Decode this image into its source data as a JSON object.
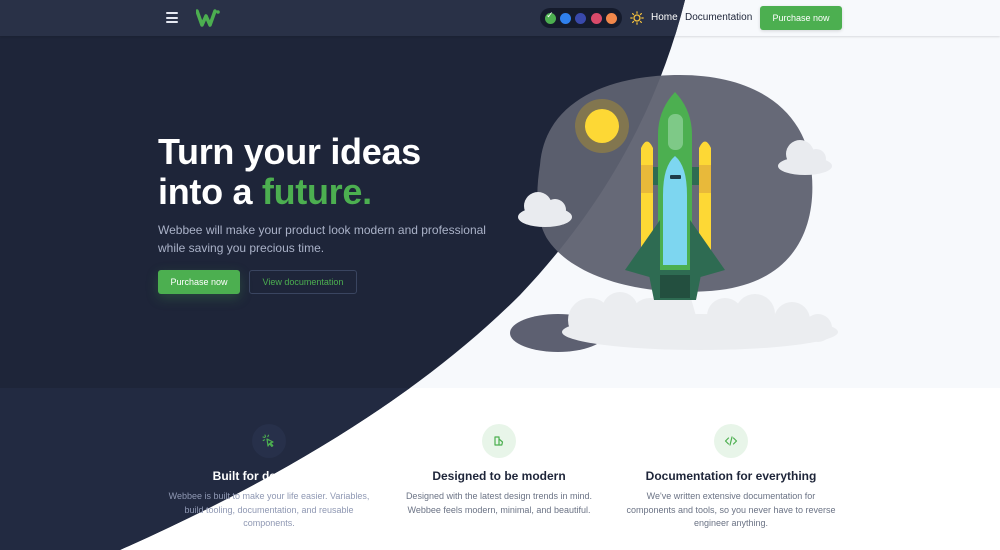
{
  "colors": {
    "dark_bg": "#1e2539",
    "accent": "#4caf50",
    "light_bg": "#f7f9fc"
  },
  "header": {
    "menu_icon": "hamburger-icon",
    "logo": "webbee-logo",
    "palette": {
      "swatches": [
        {
          "name": "green",
          "color": "#4caf50",
          "selected": true
        },
        {
          "name": "blue",
          "color": "#2f80ed"
        },
        {
          "name": "indigo",
          "color": "#3949ab"
        },
        {
          "name": "pink",
          "color": "#d94a6a"
        },
        {
          "name": "orange",
          "color": "#f2884b"
        }
      ]
    },
    "theme_toggle_icon": "sun-icon",
    "nav": {
      "home": "Home",
      "documentation": "Documentation",
      "purchase": "Purchase now"
    }
  },
  "hero": {
    "title_line1": "Turn your ideas",
    "title_line2_prefix": "into a ",
    "title_line2_accent": "future.",
    "subtitle": "Webbee will make your product look modern and professional while saving you precious time.",
    "primary_button": "Purchase now",
    "secondary_button": "View documentation",
    "illustration": "rocket-launch-illustration"
  },
  "features": [
    {
      "icon": "cursor-click-icon",
      "title": "Built for developers",
      "description": "Webbee is built to make your life easier. Variables, build tooling, documentation, and reusable components."
    },
    {
      "icon": "layers-design-icon",
      "title": "Designed to be modern",
      "description": "Designed with the latest design trends in mind. Webbee feels modern, minimal, and beautiful."
    },
    {
      "icon": "code-icon",
      "title": "Documentation for everything",
      "description": "We've written extensive documentation for components and tools, so you never have to reverse engineer anything."
    }
  ]
}
